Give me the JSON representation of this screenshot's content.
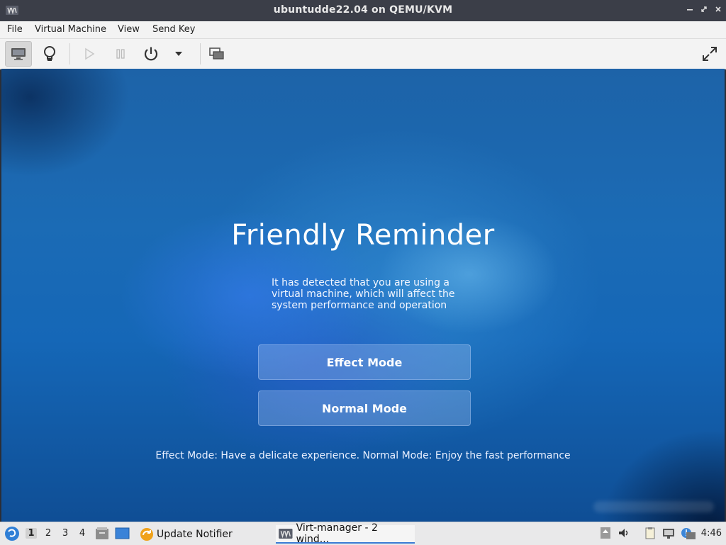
{
  "window": {
    "title": "ubuntudde22.04 on QEMU/KVM",
    "controls": [
      "minimize",
      "restore",
      "close"
    ]
  },
  "menubar": {
    "items": [
      "File",
      "Virtual Machine",
      "View",
      "Send Key"
    ]
  },
  "toolbar": {
    "buttons": [
      {
        "icon": "console-icon",
        "state": "active"
      },
      {
        "icon": "lightbulb-icon"
      },
      {
        "icon": "run-icon",
        "state": "disabled"
      },
      {
        "icon": "pause-icon",
        "state": "disabled"
      },
      {
        "icon": "power-icon"
      },
      {
        "icon": "dropdown-icon"
      },
      {
        "icon": "screenshot-icon"
      },
      {
        "icon": "fullscreen-icon"
      }
    ]
  },
  "vm": {
    "heading": "Friendly Reminder",
    "message": "It has detected that you are using a virtual machine, which will affect the system performance and operation",
    "effect_button": "Effect Mode",
    "normal_button": "Normal Mode",
    "mode_description": "Effect Mode: Have a delicate experience. Normal Mode: Enjoy the fast performance"
  },
  "taskbar": {
    "workspaces": [
      "1",
      "2",
      "3",
      "4"
    ],
    "current_workspace": "1",
    "tasks": [
      {
        "label": "Update Notifier",
        "icon": "update-notifier-icon"
      },
      {
        "label": "Virt-manager - 2 wind...",
        "icon": "virt-manager-icon",
        "active": true
      }
    ],
    "clock": "4:46"
  }
}
